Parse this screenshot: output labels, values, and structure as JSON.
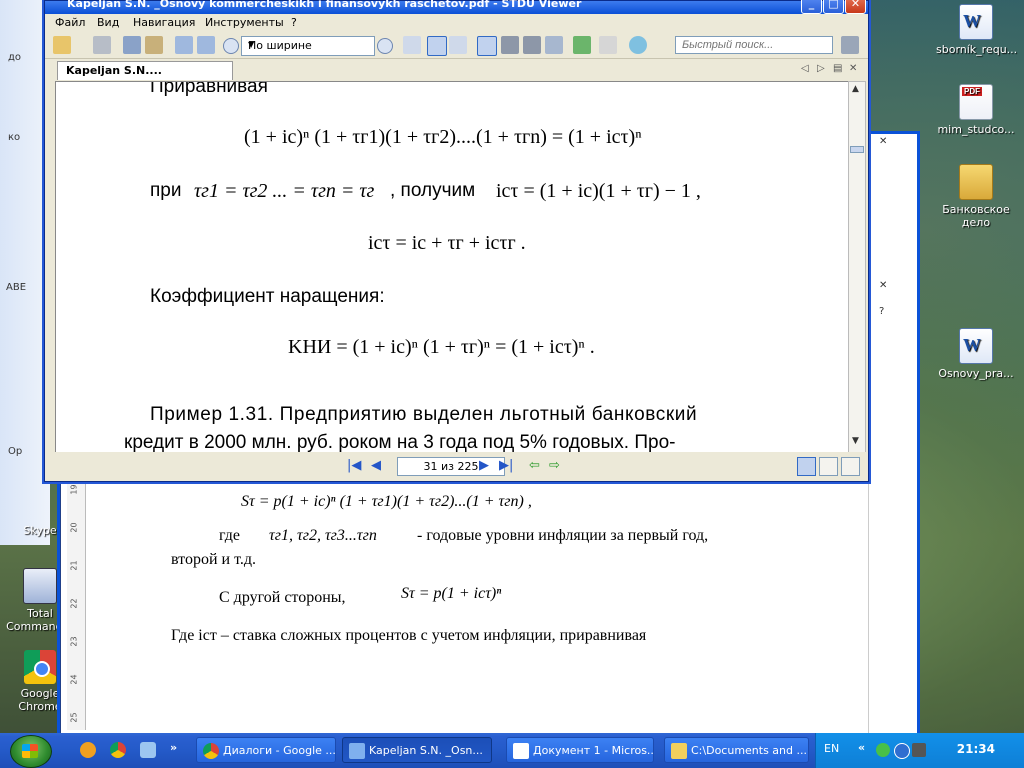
{
  "desktop": {
    "icons": [
      {
        "label": "sborník_requ...",
        "kind": "word"
      },
      {
        "label": "mim_studco...",
        "kind": "pdf"
      },
      {
        "label": "Банковское дело",
        "kind": "folder"
      },
      {
        "label": "Osnovy_pra...",
        "kind": "word"
      },
      {
        "label": "Skype",
        "kind": "skype"
      },
      {
        "label": "Total Commander",
        "kind": "tc"
      },
      {
        "label": "Google Chrome",
        "kind": "chrome"
      }
    ],
    "left_fragments": [
      "до",
      "ко",
      "Ор",
      "ABE"
    ]
  },
  "viewer": {
    "title": "Kapeljan S.N. _Osnovy kommercheskikh i finansovykh raschetov.pdf - STDU Viewer",
    "menu": [
      "Файл",
      "Вид",
      "Навигация",
      "Инструменты",
      "?"
    ],
    "zoom_value": "По ширине",
    "search_placeholder": "Быстрый поиск...",
    "tab_label": "Kapeljan S.N.... raschetov.pdf",
    "page_indicator": "31 из 225",
    "content": {
      "heading_top": "Приравнивая",
      "eq1": "(1 + iс)ⁿ (1 + τг1)(1 + τг2)....(1 + τгn) = (1 + iсτ)ⁿ",
      "line2_prefix": "при",
      "line2_cond": "τг1 = τг2 ... = τгn = τг",
      "line2_mid": ", получим",
      "line2_result": "iсτ = (1 + iс)(1 + τг) − 1 ,",
      "eq3": "iсτ = iс + τг + iсτг .",
      "coef_label": "Коэффициент наращения:",
      "eq4": "KНИ = (1 + iс)ⁿ (1 + τг)ⁿ = (1 + iсτ)ⁿ .",
      "example_line1": "Пример 1.31. Предприятию выделен льготный банковский",
      "example_line2": "кредит в 2000 млн. руб. роком на 3 года под 5% годовых. Про-"
    }
  },
  "word": {
    "lines": [
      "Sτ = p(1 + iс)ⁿ (1 + τг1)(1 + τг2)...(1 + τгn) ,",
      "где",
      "τг1, τг2, τг3...τгn",
      "- годовые уровни инфляции за первый год,",
      "второй и т.д.",
      "С другой стороны,",
      "Sτ = p(1 + iсτ)ⁿ",
      "Где iст – ставка сложных процентов с учетом инфляции, приравнивая"
    ],
    "ruler_numbers": [
      "19",
      "20",
      "21",
      "22",
      "23",
      "24",
      "25"
    ]
  },
  "taskbar": {
    "tasks": [
      {
        "label": "Диалоги - Google ...",
        "active": false
      },
      {
        "label": "Kapeljan S.N. _Osn...",
        "active": true
      },
      {
        "label": "Документ 1 - Micros...",
        "active": false
      },
      {
        "label": "C:\\Documents and ...",
        "active": false
      }
    ],
    "lang": "EN",
    "clock": "21:34",
    "more": "»"
  },
  "colors": {
    "titlebar": "#0a4fd6",
    "taskbar": "#245ac8",
    "tray": "#0e7fd6"
  }
}
